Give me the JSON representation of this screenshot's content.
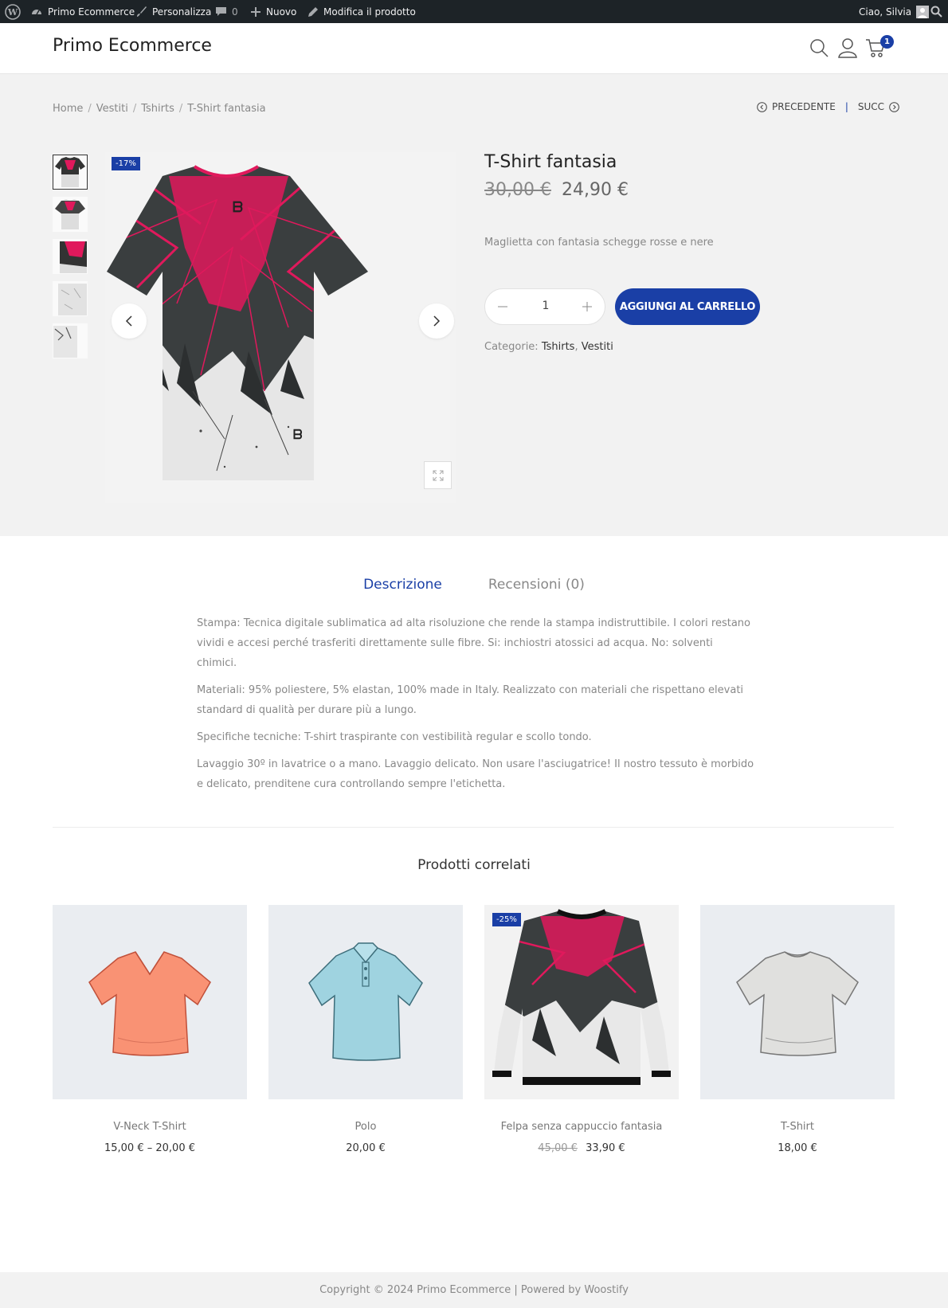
{
  "admin_bar": {
    "site_name": "Primo Ecommerce",
    "customize": "Personalizza",
    "comments_count": "0",
    "new": "Nuovo",
    "edit_product": "Modifica il prodotto",
    "greeting": "Ciao, Silvia"
  },
  "header": {
    "site_title": "Primo Ecommerce",
    "cart_count": "1"
  },
  "breadcrumb": {
    "items": [
      "Home",
      "Vestiti",
      "Tshirts",
      "T-Shirt fantasia"
    ],
    "separator": "/"
  },
  "product_nav": {
    "prev": "PRECEDENTE",
    "next": "SUCC",
    "divider": "|"
  },
  "product": {
    "sale_badge": "-17%",
    "title": "T-Shirt fantasia",
    "old_price": "30,00 €",
    "price": "24,90 €",
    "short_description": "Maglietta con fantasia schegge rosse e nere",
    "quantity": "1",
    "add_to_cart": "AGGIUNGI AL CARRELLO",
    "categories_label": "Categorie:",
    "categories": [
      "Tshirts",
      "Vestiti"
    ],
    "category_separator": ","
  },
  "tabs": {
    "description": "Descrizione",
    "reviews": "Recensioni (0)"
  },
  "description": [
    "Stampa: Tecnica digitale sublimatica ad alta risoluzione che rende la stampa indistruttibile. I colori restano vividi e accesi perché trasferiti direttamente sulle fibre. Si: inchiostri atossici ad acqua. No: solventi chimici.",
    "Materiali: 95% poliestere, 5% elastan, 100% made in Italy. Realizzato con materiali che rispettano elevati standard di qualità per durare più a lungo.",
    "Specifiche tecniche: T-shirt traspirante con vestibilità regular e scollo tondo.",
    "Lavaggio 30º in lavatrice o a mano. Lavaggio delicato. Non usare l'asciugatrice! Il nostro tessuto è morbido e delicato, prenditene cura controllando sempre l'etichetta."
  ],
  "related": {
    "title": "Prodotti correlati",
    "products": [
      {
        "name": "V-Neck T-Shirt",
        "price": "15,00 € – 20,00 €",
        "old_price": "",
        "badge": ""
      },
      {
        "name": "Polo",
        "price": "20,00 €",
        "old_price": "",
        "badge": ""
      },
      {
        "name": "Felpa senza cappuccio fantasia",
        "price": "33,90 €",
        "old_price": "45,00 €",
        "badge": "-25%"
      },
      {
        "name": "T-Shirt",
        "price": "18,00 €",
        "old_price": "",
        "badge": ""
      }
    ]
  },
  "footer": {
    "text": "Copyright © 2024 Primo Ecommerce | Powered by Woostify"
  },
  "colors": {
    "accent": "#1a3fa6",
    "admin_bar": "#1d2327",
    "band": "#f2f2f2",
    "tee_pink": "#e0195c"
  },
  "icons": [
    "wordpress-icon",
    "dashboard-icon",
    "brush-icon",
    "comment-icon",
    "plus-icon",
    "pencil-icon",
    "avatar-icon",
    "search-icon",
    "user-icon",
    "cart-icon",
    "chevron-left-icon",
    "chevron-right-icon",
    "expand-icon",
    "minus-icon"
  ]
}
